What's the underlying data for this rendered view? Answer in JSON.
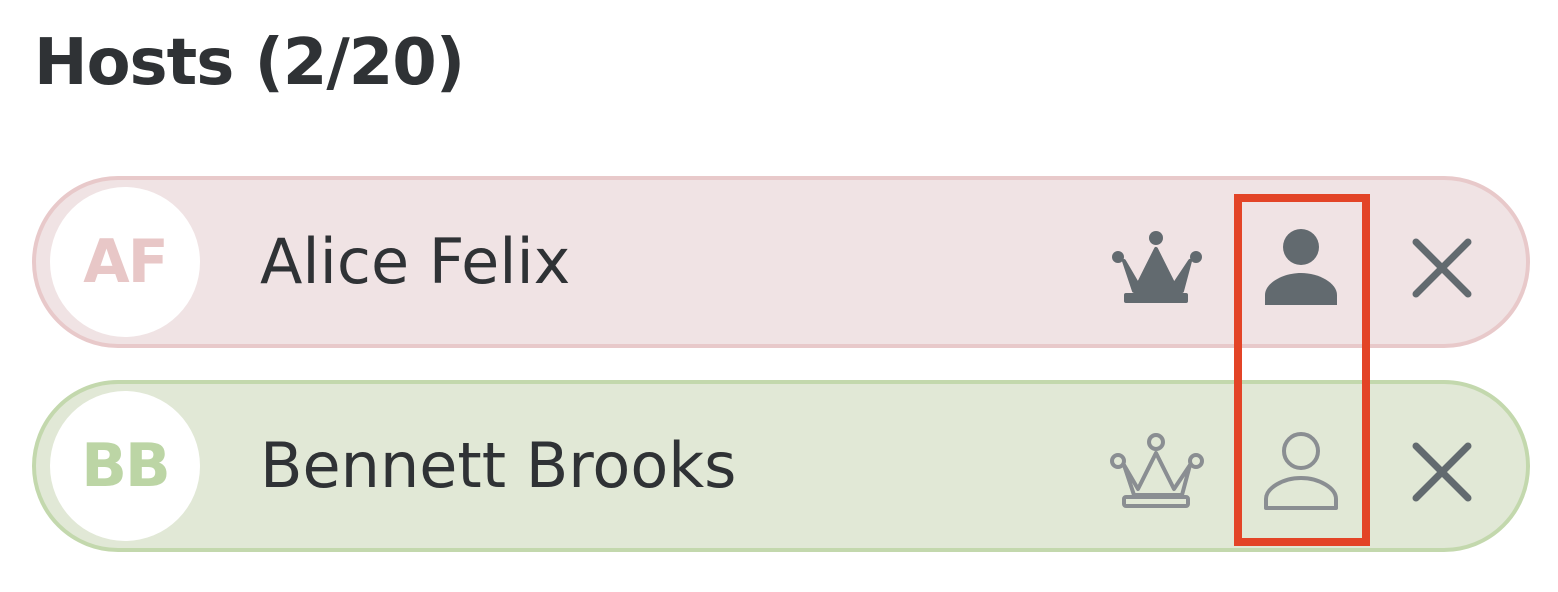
{
  "panel": {
    "title": "Hosts (2/20)"
  },
  "hosts": [
    {
      "initials": "AF",
      "name": "Alice Felix",
      "is_owner": true,
      "is_host": true,
      "row_color": "#f0e3e4",
      "avatar_color": "#e8c7c7",
      "icons": [
        "crown-filled-icon",
        "person-filled-icon",
        "close-icon"
      ]
    },
    {
      "initials": "BB",
      "name": "Bennett Brooks",
      "is_owner": false,
      "is_host": false,
      "row_color": "#e1e8d6",
      "avatar_color": "#bcd5a5",
      "icons": [
        "crown-outline-icon",
        "person-outline-icon",
        "close-icon"
      ]
    }
  ],
  "colors": {
    "text": "#2f3235",
    "icon": "#626a6f",
    "icon_outline": "#8a8e92",
    "highlight": "#e34427"
  }
}
